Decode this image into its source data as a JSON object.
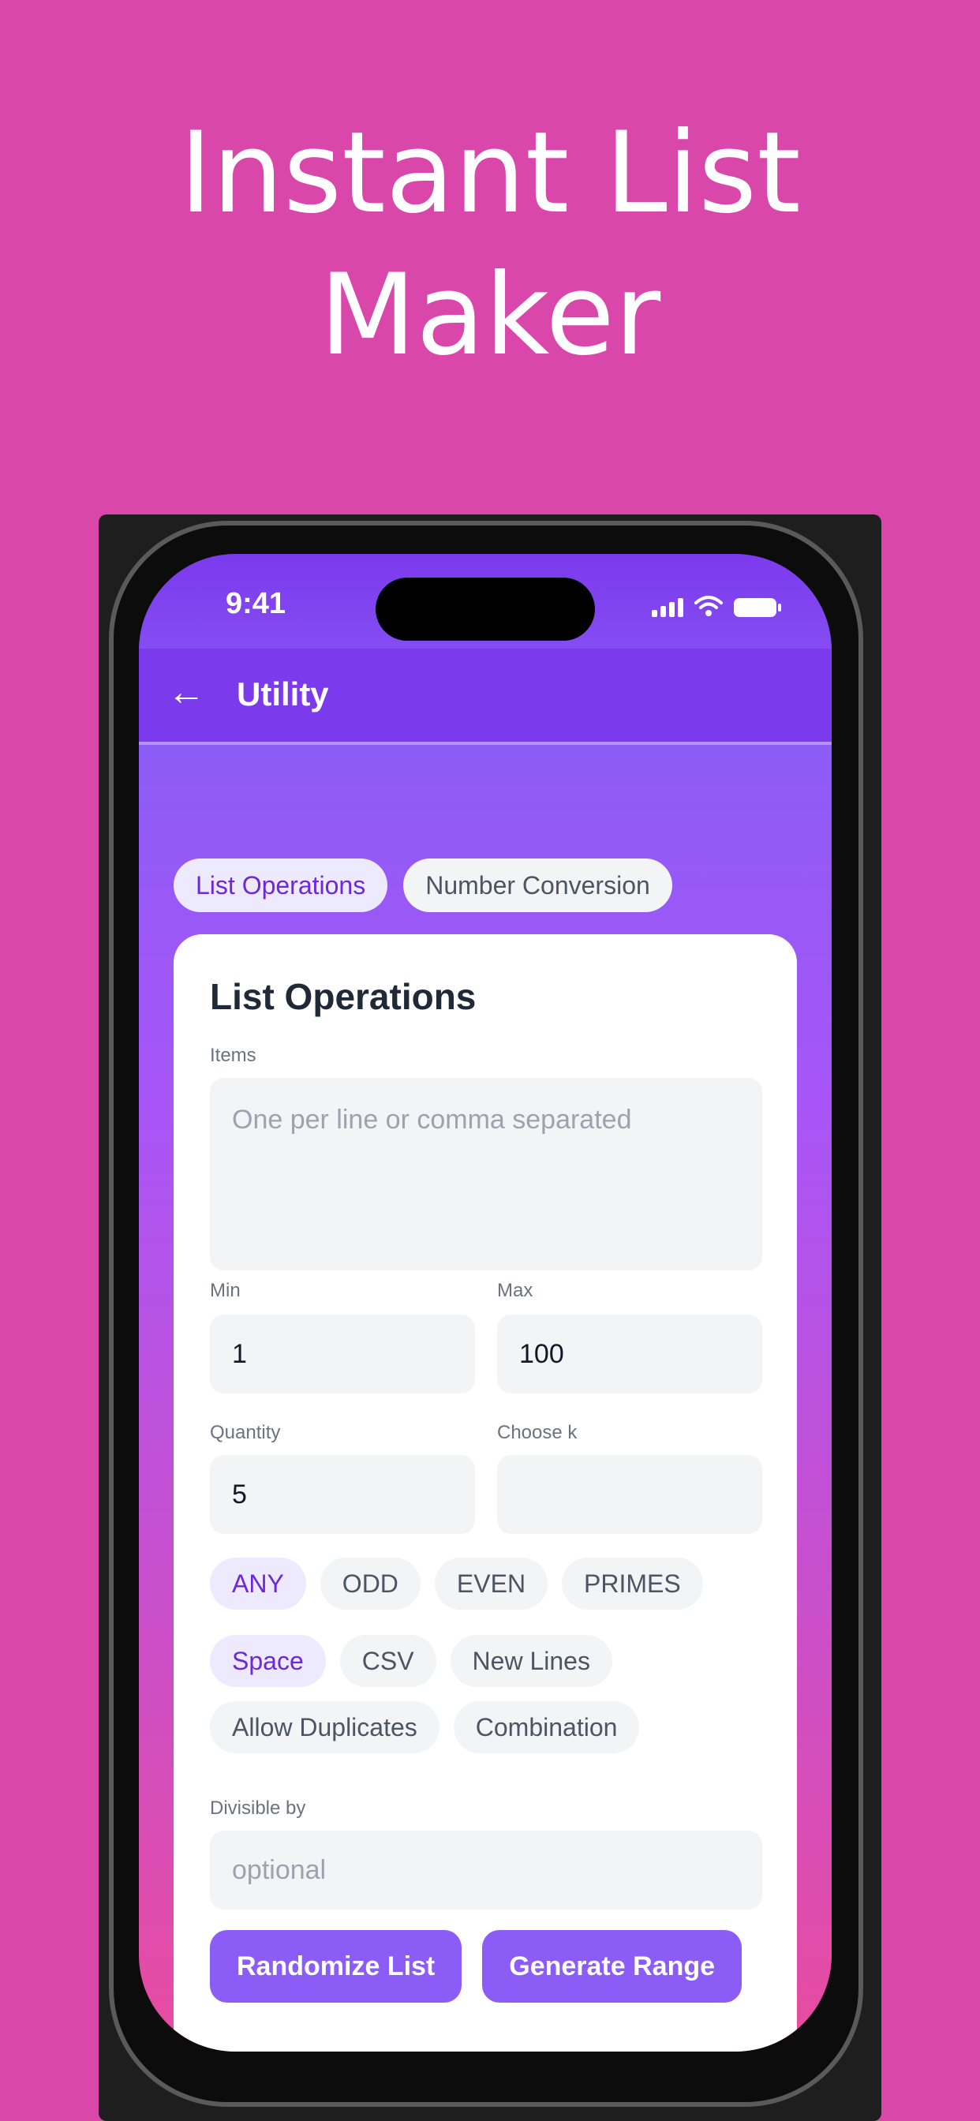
{
  "headline": {
    "line1": "Instant List",
    "line2": "Maker"
  },
  "status_bar": {
    "time": "9:41",
    "icons": [
      "signal-icon",
      "wifi-icon",
      "battery-icon"
    ]
  },
  "appbar": {
    "back_icon": "arrow-left-icon",
    "title": "Utility"
  },
  "tabs": [
    {
      "label": "List Operations",
      "active": true
    },
    {
      "label": "Number Conversion",
      "active": false
    }
  ],
  "card": {
    "title": "List Operations",
    "items": {
      "label": "Items",
      "placeholder": "One per line or comma separated",
      "value": ""
    },
    "min": {
      "label": "Min",
      "value": "1"
    },
    "max": {
      "label": "Max",
      "value": "100"
    },
    "quantity": {
      "label": "Quantity",
      "value": "5"
    },
    "choose_k": {
      "label": "Choose k",
      "value": ""
    },
    "number_filters": [
      {
        "label": "ANY",
        "selected": true
      },
      {
        "label": "ODD",
        "selected": false
      },
      {
        "label": "EVEN",
        "selected": false
      },
      {
        "label": "PRIMES",
        "selected": false
      }
    ],
    "separators": [
      {
        "label": "Space",
        "selected": true
      },
      {
        "label": "CSV",
        "selected": false
      },
      {
        "label": "New Lines",
        "selected": false
      }
    ],
    "options": [
      {
        "label": "Allow Duplicates",
        "selected": false
      },
      {
        "label": "Combination",
        "selected": false
      }
    ],
    "divisible_by": {
      "label": "Divisible by",
      "placeholder": "optional",
      "value": ""
    },
    "buttons": {
      "randomize": "Randomize List",
      "generate_range": "Generate Range"
    }
  },
  "colors": {
    "page_background": "#da47aa",
    "primary": "#7c3aed",
    "button": "#8b5cf6",
    "chip_selected_bg": "#ede9fe",
    "chip_selected_text": "#6d28d9"
  }
}
